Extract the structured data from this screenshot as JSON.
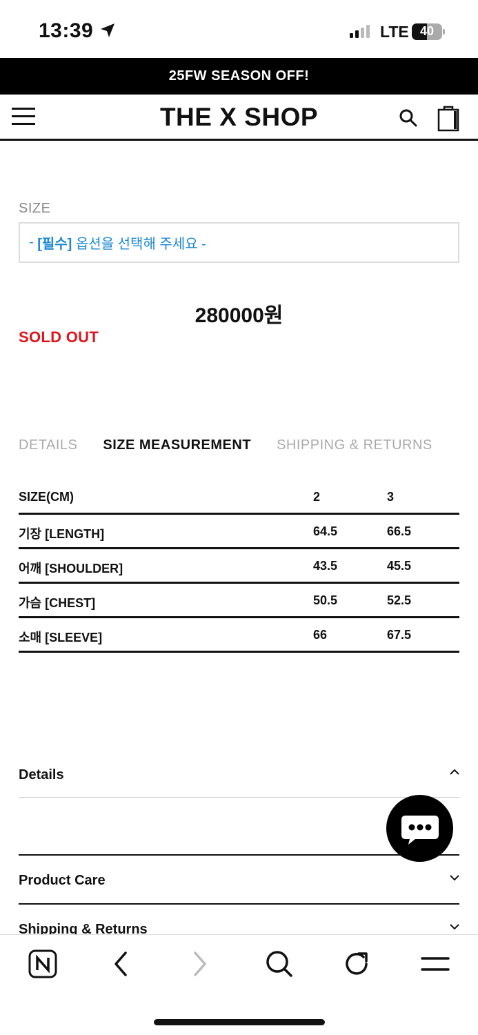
{
  "status_bar": {
    "time": "13:39",
    "network": "LTE",
    "battery": "40"
  },
  "promo": {
    "text": "25FW SEASON OFF!"
  },
  "header": {
    "logo": "THE X SHOP"
  },
  "product": {
    "size_label": "SIZE",
    "select_dash_left": "- ",
    "select_required": "[필수]",
    "select_text": " 옵션을 선택해 주세요 -",
    "price": "280000원",
    "status": "SOLD OUT"
  },
  "tabs": [
    {
      "label": "DETAILS",
      "active": false
    },
    {
      "label": "SIZE MEASUREMENT",
      "active": true
    },
    {
      "label": "SHIPPING & RETURNS",
      "active": false
    }
  ],
  "measurement_table": {
    "headers": [
      "SIZE(CM)",
      "2",
      "3"
    ],
    "rows": [
      [
        "기장 [LENGTH]",
        "64.5",
        "66.5"
      ],
      [
        "어깨 [SHOULDER]",
        "43.5",
        "45.5"
      ],
      [
        "가슴 [CHEST]",
        "50.5",
        "52.5"
      ],
      [
        "소매 [SLEEVE]",
        "66",
        "67.5"
      ]
    ]
  },
  "accordion": [
    {
      "label": "Details",
      "state": "expanded"
    },
    {
      "label": "Product Care",
      "state": "collapsed"
    },
    {
      "label": "Shipping & Returns",
      "state": "collapsed"
    }
  ],
  "colors": {
    "sold_out": "#e0161f",
    "option_select": "#1e88d6",
    "banner_bg": "#000000"
  },
  "icons": {
    "header": [
      "menu-icon",
      "search-icon",
      "shopping-bag-icon"
    ],
    "toolbar": [
      "naver-home-icon",
      "back-icon",
      "forward-icon",
      "search-icon",
      "refresh-icon",
      "menu-icon"
    ],
    "chat": "chat-bubble-icon"
  }
}
